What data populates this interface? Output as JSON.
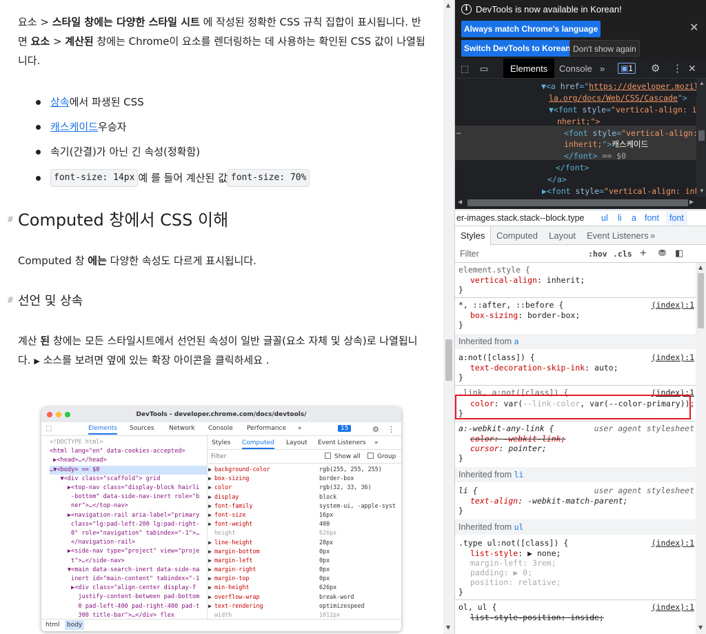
{
  "doc": {
    "para1_parts": [
      "요소 > ",
      "스타일 창에는 다양한 스타일 시트",
      " 에 작성된 정확한 CSS 규칙 집합이 표시됩니다. 반면 ",
      "요소",
      " > ",
      "계산된",
      " 창에는 Chrome이 요소를 렌더링하는 데 사용하는 확인된 CSS 값이 나열됩니다."
    ],
    "list": [
      {
        "link": "상속",
        "text": " 에서 파생된 CSS"
      },
      {
        "link": "캐스케이드",
        "text": " 우승자"
      },
      {
        "link": "",
        "text": "속기(간결)가 아닌 긴 속성(정확함)"
      }
    ],
    "list4": {
      "code1": "font-size: 14px",
      "mid": "예 를 들어 계산된 값",
      "code2": "font-size: 70%"
    },
    "h2": "Computed 창에서 CSS 이해",
    "para2_parts": [
      "Computed 창 ",
      "에는",
      " 다양한 속성도 다르게 표시됩니다."
    ],
    "h3": "선언 및 상속",
    "para3_parts": [
      "계산 ",
      "된",
      " 창에는 모든 스타일시트에서 선언된 속성이 일반 글꼴(요소 자체 및 상속)로 나열됩니다. ",
      "▶",
      " 소스를 보려면 옆에 있는 확장 아이콘을 클릭하세요 ."
    ],
    "hash": "#"
  },
  "shot": {
    "title": "DevTools - developer.chrome.com/docs/devtools/",
    "tabs": [
      "Elements",
      "Sources",
      "Network",
      "Console",
      "Performance",
      "»",
      "15"
    ],
    "elements_lines": [
      "<!DOCTYPE html>",
      "<html lang=\"en\" data-cookies-accepted>",
      " ▶<head>…</head>",
      "…▼<body> == $0",
      "   ▼<div class=\"scaffold\"> grid",
      "     ▶<top-nav class=\"display-block hairli",
      "      -bottom\" data-side-nav-inert role=\"b",
      "      ner\">…</top-nav>",
      "     ▶<navigation-rail aria-label=\"primary",
      "      class=\"lg:pad-left-200 lg:pad-right-",
      "      0\" role=\"navigation\" tabindex=\"-1\">…",
      "      </navigation-rail>",
      "     ▶<side-nav type=\"project\" view=\"proje",
      "      t\">…</side-nav>",
      "     ▼<main data-search-inert data-side-na",
      "      inert id=\"main-content\" tabindex=\"-1",
      "      ▶<div class=\"align-center display-f",
      "        justify-content-between pad-bottom",
      "        0 pad-left-400 pad-right-400 pad-t",
      "        300 title-bar\">…</div> flex"
    ],
    "side_tabs": [
      "Styles",
      "Computed",
      "Layout",
      "Event Listeners",
      "»"
    ],
    "filter": "Filter",
    "show_all": "Show all",
    "group": "Group",
    "props": [
      {
        "k": "background-color",
        "v": "rgb(255, 255, 255)",
        "dim": false
      },
      {
        "k": "box-sizing",
        "v": "border-box",
        "dim": false
      },
      {
        "k": "color",
        "v": "rgb(32, 33, 36)",
        "dim": false
      },
      {
        "k": "display",
        "v": "block",
        "dim": false
      },
      {
        "k": "font-family",
        "v": "system-ui, -apple-syst",
        "dim": false
      },
      {
        "k": "font-size",
        "v": "16px",
        "dim": false
      },
      {
        "k": "font-weight",
        "v": "400",
        "dim": false
      },
      {
        "k": "height",
        "v": "626px",
        "dim": true
      },
      {
        "k": "line-height",
        "v": "28px",
        "dim": false
      },
      {
        "k": "margin-bottom",
        "v": "0px",
        "dim": false
      },
      {
        "k": "margin-left",
        "v": "0px",
        "dim": false
      },
      {
        "k": "margin-right",
        "v": "0px",
        "dim": false
      },
      {
        "k": "margin-top",
        "v": "0px",
        "dim": false
      },
      {
        "k": "min-height",
        "v": "626px",
        "dim": false
      },
      {
        "k": "overflow-wrap",
        "v": "break-word",
        "dim": false
      },
      {
        "k": "text-rendering",
        "v": "optimizespeed",
        "dim": false
      },
      {
        "k": "width",
        "v": "1012px",
        "dim": true
      }
    ],
    "bc": [
      "html",
      "body"
    ]
  },
  "devtools": {
    "infobar": {
      "message": "DevTools is now available in Korean!",
      "btn1": "Always match Chrome's language",
      "btn2": "Switch DevTools to Korean",
      "btn3": "Don't show again"
    },
    "tabs": {
      "elements": "Elements",
      "console": "Console",
      "more": "»",
      "issues": "1"
    },
    "dom": {
      "l1_tag": "<a ",
      "l1_attr": "href",
      "l1_val": "https://developer.mozil",
      "l2_val": "la.org/docs/Web/CSS/Cascade",
      "l2_end": "\">",
      "l3": "▼<font ",
      "l3_attr": "style",
      "l3_val": "\"vertical-align: i",
      "l4_val": "nherit;\">",
      "l5": "<font ",
      "l5_val": "\"vertical-align:",
      "l6_val": "inherit;",
      "l6_end": "\">",
      "l6_text": "캐스케이드",
      "l7": "</font>",
      "l7_eq": " == $0",
      "l8": "</font>",
      "l9": "</a>",
      "l10": "▶<font ",
      "l10_attr": "style",
      "l10_val": "\"vertical-align: inh"
    },
    "crumbs": [
      "er-images.stack.stack--block.type",
      "ul",
      "li",
      "a",
      "font",
      "font"
    ],
    "subtabs": [
      "Styles",
      "Computed",
      "Layout",
      "Event Listeners",
      "»"
    ],
    "filter_placeholder": "Filter",
    "hov": ":hov",
    "cls": ".cls",
    "styles": {
      "element_style": "element.style {",
      "es_prop": "vertical-align",
      "es_val": "inherit;",
      "close": "}",
      "univ_sel": "*, ::after, ::before {",
      "src_index": "(index):1",
      "univ_prop": "box-sizing",
      "univ_val": "border-box;",
      "inh_a_label": "Inherited from ",
      "inh_a": "a",
      "anot_sel": "a:not([class]) {",
      "anot_prop": "text-decoration-skip-ink",
      "anot_val": "auto;",
      "link_sel": ".link, a:not([class]) {",
      "color_prop": "color",
      "color_val_pre": "var(",
      "color_var1": "--link-color",
      "color_val_post": ", var(--color-primary));",
      "wk_sel": "a:-webkit-any-link {",
      "ua_label": "user agent stylesheet",
      "wk_prop1": "color: -webkit-link;",
      "wk_prop2": "cursor",
      "wk_val2": "pointer;",
      "inh_li": "li",
      "li_sel": "li {",
      "li_prop": "text-align",
      "li_val": "-webkit-match-parent;",
      "inh_ul": "ul",
      "ul_sel": ".type ul:not([class]) {",
      "ul_p1": "list-style",
      "ul_v1": "▶ none;",
      "ul_p2": "margin-left",
      "ul_v2": "3rem;",
      "ul_p3": "padding",
      "ul_v3": "▶ 0;",
      "ul_p4": "position",
      "ul_v4": "relative;",
      "olul_sel": "ol, ul {",
      "olul_prop": "list-style-position: inside;"
    }
  },
  "colors": {
    "accent": "#1a73e8",
    "highlight_box": "#e5191f",
    "prop_name": "#c80000"
  }
}
